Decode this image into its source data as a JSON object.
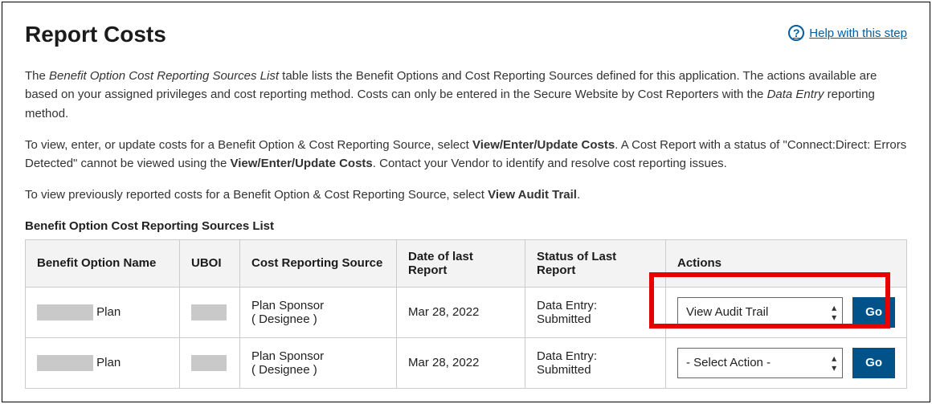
{
  "page": {
    "title": "Report Costs",
    "help_label": "Help with this step"
  },
  "intro": {
    "p1_a": "The ",
    "p1_i": "Benefit Option Cost Reporting Sources List",
    "p1_b": " table lists the Benefit Options and Cost Reporting Sources defined for this application. The actions available are based on your assigned privileges and cost reporting method. Costs can only be entered in the Secure Website by Cost Reporters with the ",
    "p1_i2": "Data Entry",
    "p1_c": " reporting method.",
    "p2_a": "To view, enter, or update costs for a Benefit Option & Cost Reporting Source, select ",
    "p2_b1": "View/Enter/Update Costs",
    "p2_b": ". A Cost Report with a status of \"Connect:Direct: Errors Detected\" cannot be viewed using the ",
    "p2_b2": "View/Enter/Update Costs",
    "p2_c": ". Contact your Vendor to identify and resolve cost reporting issues.",
    "p3_a": "To view previously reported costs for a Benefit Option & Cost Reporting Source, select ",
    "p3_b1": "View Audit Trail",
    "p3_b": "."
  },
  "table": {
    "title": "Benefit Option Cost Reporting Sources List",
    "headers": {
      "name": "Benefit Option Name",
      "uboi": "UBOI",
      "source": "Cost Reporting Source",
      "date": "Date of last Report",
      "status": "Status of Last Report",
      "actions": "Actions"
    },
    "rows": [
      {
        "name_suffix": " Plan",
        "source_l1": "Plan Sponsor",
        "source_l2": "( Designee )",
        "date": "Mar 28, 2022",
        "status": "Data Entry: Submitted",
        "select_value": "View Audit Trail",
        "go_label": "Go"
      },
      {
        "name_suffix": " Plan",
        "source_l1": "Plan Sponsor",
        "source_l2": "( Designee )",
        "date": "Mar 28, 2022",
        "status": "Data Entry: Submitted",
        "select_value": "- Select Action -",
        "go_label": "Go"
      }
    ]
  }
}
